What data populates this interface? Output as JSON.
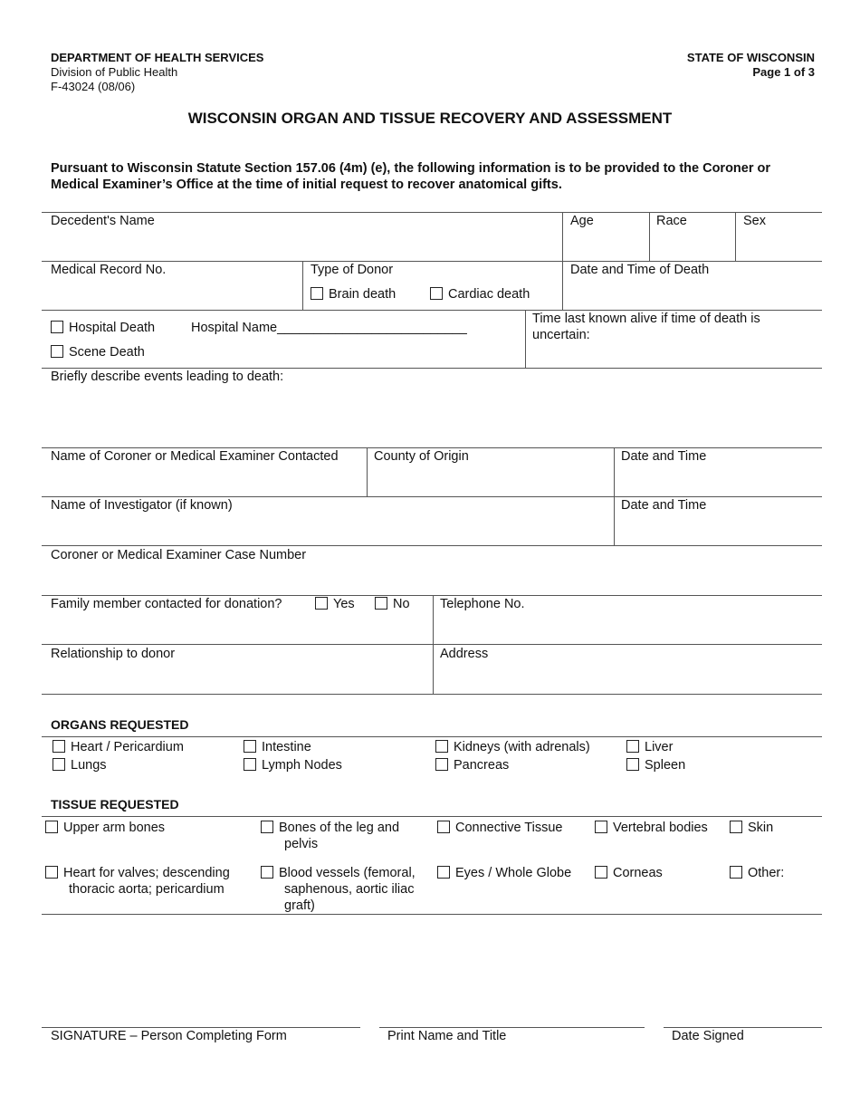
{
  "header": {
    "department": "DEPARTMENT OF HEALTH SERVICES",
    "division": "Division of Public Health",
    "form_id": "F-43024 (08/06)",
    "state": "STATE OF WISCONSIN",
    "page": "Page 1 of 3"
  },
  "title": "WISCONSIN ORGAN AND TISSUE RECOVERY AND ASSESSMENT",
  "intro": "Pursuant to Wisconsin Statute Section 157.06 (4m) (e), the following information is to be provided to the Coroner or Medical Examiner’s Office at the time of initial request to recover anatomical gifts.",
  "fields": {
    "decedent_name": "Decedent's Name",
    "age": "Age",
    "race": "Race",
    "sex": "Sex",
    "medical_record": "Medical Record No.",
    "type_of_donor": "Type of Donor",
    "brain_death": "Brain death",
    "cardiac_death": "Cardiac death",
    "date_time_death": "Date and Time of Death",
    "hospital_death": "Hospital Death",
    "hospital_name": "Hospital Name__________________________",
    "scene_death": "Scene Death",
    "time_last_alive": "Time last known alive if time of death is uncertain:",
    "events": "Briefly describe events leading to death:",
    "coroner_name": "Name of Coroner or Medical Examiner Contacted",
    "county": "County of Origin",
    "date_time_1": "Date and Time",
    "investigator": "Name of Investigator (if known)",
    "date_time_2": "Date and Time",
    "case_number": "Coroner or Medical Examiner Case Number",
    "family_contacted": "Family member contacted for donation?",
    "yes": "Yes",
    "no": "No",
    "telephone": "Telephone No.",
    "relationship": "Relationship to donor",
    "address": "Address"
  },
  "organs": {
    "heading": "ORGANS REQUESTED",
    "items": [
      "Heart / Pericardium",
      "Intestine",
      "Kidneys (with adrenals)",
      "Liver",
      "Lungs",
      "Lymph Nodes",
      "Pancreas",
      "Spleen"
    ]
  },
  "tissue": {
    "heading": "TISSUE REQUESTED",
    "items": [
      "Upper arm bones",
      "Bones of the leg and pelvis",
      "Connective Tissue",
      "Vertebral bodies",
      "Skin",
      "Heart for valves; descending thoracic aorta; pericardium",
      "Blood vessels (femoral, saphenous, aortic iliac graft)",
      "Eyes / Whole Globe",
      "Corneas",
      "Other:"
    ]
  },
  "signature": {
    "signature": "SIGNATURE – Person Completing Form",
    "print_name": "Print Name and Title",
    "date_signed": "Date Signed"
  }
}
